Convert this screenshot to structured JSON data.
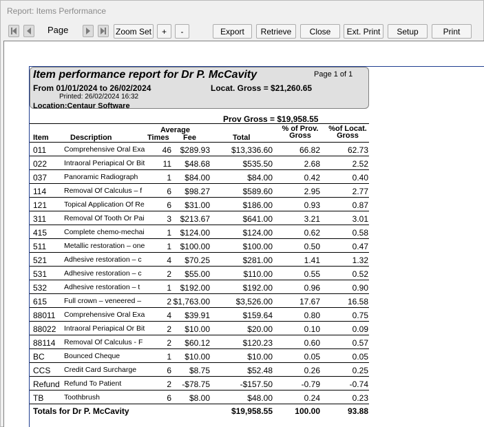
{
  "window": {
    "title": "Report: Items Performance"
  },
  "toolbar": {
    "page_label": "Page",
    "zoom_set": "Zoom Set",
    "zoom_in": "+",
    "zoom_out": "-",
    "export": "Export",
    "retrieve": "Retrieve",
    "close": "Close",
    "ext_print": "Ext. Print",
    "setup": "Setup",
    "print": "Print"
  },
  "report": {
    "title": "Item performance report for Dr P. McCavity",
    "page_info": "Page 1 of 1",
    "from_range": "From  01/01/2024  to  26/02/2024",
    "locat_gross": "Locat. Gross = $21,260.65",
    "printed": "Printed: 26/02/2024 16:32",
    "location_label": "Location:",
    "location_value": "Centaur Software",
    "prov_gross": "Prov Gross = $19,958.55",
    "columns": {
      "item": "Item",
      "description": "Description",
      "average": "Average",
      "times": "Times",
      "fee": "Fee",
      "total": "Total",
      "pct_prov_1": "% of Prov.",
      "pct_prov_2": "Gross",
      "pct_locat_1": "%of Locat.",
      "pct_locat_2": "Gross"
    },
    "rows": [
      {
        "item": "011",
        "desc": "Comprehensive Oral Exa",
        "times": "46",
        "fee": "$289.93",
        "total": "$13,336.60",
        "prov": "66.82",
        "loc": "62.73"
      },
      {
        "item": "022",
        "desc": "Intraoral Periapical Or Bit",
        "times": "11",
        "fee": "$48.68",
        "total": "$535.50",
        "prov": "2.68",
        "loc": "2.52"
      },
      {
        "item": "037",
        "desc": "Panoramic Radiograph",
        "times": "1",
        "fee": "$84.00",
        "total": "$84.00",
        "prov": "0.42",
        "loc": "0.40"
      },
      {
        "item": "114",
        "desc": "Removal Of Calculus – f",
        "times": "6",
        "fee": "$98.27",
        "total": "$589.60",
        "prov": "2.95",
        "loc": "2.77"
      },
      {
        "item": "121",
        "desc": "Topical Application Of Re",
        "times": "6",
        "fee": "$31.00",
        "total": "$186.00",
        "prov": "0.93",
        "loc": "0.87"
      },
      {
        "item": "311",
        "desc": "Removal Of Tooth Or Pai",
        "times": "3",
        "fee": "$213.67",
        "total": "$641.00",
        "prov": "3.21",
        "loc": "3.01"
      },
      {
        "item": "415",
        "desc": "Complete chemo-mechai",
        "times": "1",
        "fee": "$124.00",
        "total": "$124.00",
        "prov": "0.62",
        "loc": "0.58"
      },
      {
        "item": "511",
        "desc": "Metallic restoration – one",
        "times": "1",
        "fee": "$100.00",
        "total": "$100.00",
        "prov": "0.50",
        "loc": "0.47"
      },
      {
        "item": "521",
        "desc": "Adhesive restoration – c",
        "times": "4",
        "fee": "$70.25",
        "total": "$281.00",
        "prov": "1.41",
        "loc": "1.32"
      },
      {
        "item": "531",
        "desc": "Adhesive restoration – c",
        "times": "2",
        "fee": "$55.00",
        "total": "$110.00",
        "prov": "0.55",
        "loc": "0.52"
      },
      {
        "item": "532",
        "desc": "Adhesive restoration – t",
        "times": "1",
        "fee": "$192.00",
        "total": "$192.00",
        "prov": "0.96",
        "loc": "0.90"
      },
      {
        "item": "615",
        "desc": "Full crown – veneered –",
        "times": "2",
        "fee": "$1,763.00",
        "total": "$3,526.00",
        "prov": "17.67",
        "loc": "16.58"
      },
      {
        "item": "88011",
        "desc": "Comprehensive Oral Exa",
        "times": "4",
        "fee": "$39.91",
        "total": "$159.64",
        "prov": "0.80",
        "loc": "0.75"
      },
      {
        "item": "88022",
        "desc": "Intraoral Periapical Or Bit",
        "times": "2",
        "fee": "$10.00",
        "total": "$20.00",
        "prov": "0.10",
        "loc": "0.09"
      },
      {
        "item": "88114",
        "desc": "Removal Of Calculus - F",
        "times": "2",
        "fee": "$60.12",
        "total": "$120.23",
        "prov": "0.60",
        "loc": "0.57"
      },
      {
        "item": "BC",
        "desc": "Bounced Cheque",
        "times": "1",
        "fee": "$10.00",
        "total": "$10.00",
        "prov": "0.05",
        "loc": "0.05"
      },
      {
        "item": "CCS",
        "desc": "Credit Card Surcharge",
        "times": "6",
        "fee": "$8.75",
        "total": "$52.48",
        "prov": "0.26",
        "loc": "0.25"
      },
      {
        "item": "Refund",
        "desc": "Refund To Patient",
        "times": "2",
        "fee": "-$78.75",
        "total": "-$157.50",
        "prov": "-0.79",
        "loc": "-0.74"
      },
      {
        "item": "TB",
        "desc": "Toothbrush",
        "times": "6",
        "fee": "$8.00",
        "total": "$48.00",
        "prov": "0.24",
        "loc": "0.23"
      }
    ],
    "totals": {
      "label": "Totals for Dr P. McCavity",
      "total": "$19,958.55",
      "prov": "100.00",
      "loc": "93.88"
    }
  }
}
